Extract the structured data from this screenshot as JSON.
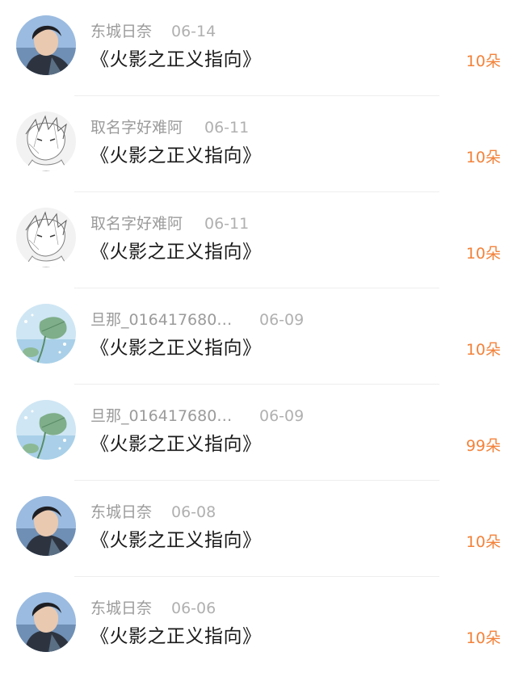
{
  "colors": {
    "username": "#9b9b9b",
    "date": "#b0b0b0",
    "title": "#1a1a1a",
    "gift_count": "#f3823a",
    "divider": "#eeeeee"
  },
  "records": [
    {
      "avatar": "boy-photo-avatar",
      "username": "东城日奈",
      "date": "06-14",
      "title": "《火影之正义指向》",
      "gift_count": "10朵"
    },
    {
      "avatar": "anime-sketch-avatar",
      "username": "取名字好难阿",
      "date": "06-11",
      "title": "《火影之正义指向》",
      "gift_count": "10朵"
    },
    {
      "avatar": "anime-sketch-avatar",
      "username": "取名字好难阿",
      "date": "06-11",
      "title": "《火影之正义指向》",
      "gift_count": "10朵"
    },
    {
      "avatar": "leaf-avatar",
      "username": "旦那_016417680…",
      "date": "06-09",
      "title": "《火影之正义指向》",
      "gift_count": "10朵"
    },
    {
      "avatar": "leaf-avatar",
      "username": "旦那_016417680…",
      "date": "06-09",
      "title": "《火影之正义指向》",
      "gift_count": "99朵"
    },
    {
      "avatar": "boy-photo-avatar",
      "username": "东城日奈",
      "date": "06-08",
      "title": "《火影之正义指向》",
      "gift_count": "10朵"
    },
    {
      "avatar": "boy-photo-avatar",
      "username": "东城日奈",
      "date": "06-06",
      "title": "《火影之正义指向》",
      "gift_count": "10朵"
    }
  ]
}
